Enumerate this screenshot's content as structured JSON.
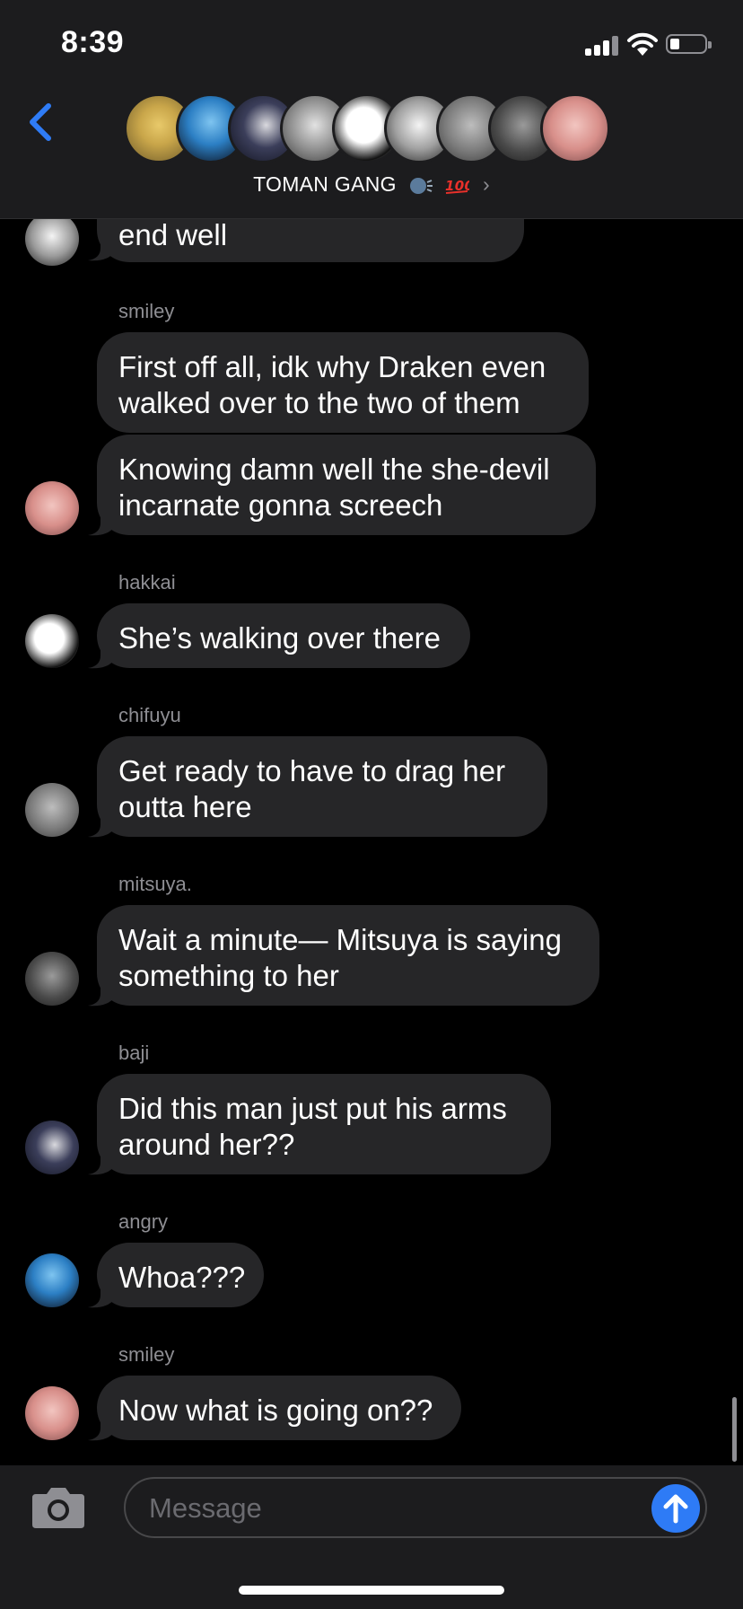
{
  "status_bar": {
    "time": "8:39"
  },
  "header": {
    "group_name": "TOMAN GANG",
    "group_emoji": [
      "speaking-head-emoji",
      "hundred-points-emoji"
    ],
    "avatar_count": 9
  },
  "messages": [
    {
      "sender": "",
      "text": "end well",
      "has_avatar": true
    },
    {
      "sender": "smiley",
      "text": "First off all, idk why Draken even walked over to the two of them",
      "has_avatar": false
    },
    {
      "sender": "",
      "text": "Knowing damn well the she-devil incarnate gonna screech",
      "has_avatar": true
    },
    {
      "sender": "hakkai",
      "text": "She’s walking over there",
      "has_avatar": true
    },
    {
      "sender": "chifuyu",
      "text": "Get ready to have to drag her outta here",
      "has_avatar": true
    },
    {
      "sender": "mitsuya.",
      "text": "Wait a minute— Mitsuya is saying something to her",
      "has_avatar": true
    },
    {
      "sender": "baji",
      "text": "Did this man just put his arms around her??",
      "has_avatar": true
    },
    {
      "sender": "angry",
      "text": "Whoa???",
      "has_avatar": true
    },
    {
      "sender": "smiley",
      "text": "Now what is going on??",
      "has_avatar": true
    }
  ],
  "composer": {
    "placeholder": "Message"
  },
  "colors": {
    "bubble": "#262628",
    "accent": "#2e7bf6",
    "secondary_text": "#8e8e93"
  }
}
